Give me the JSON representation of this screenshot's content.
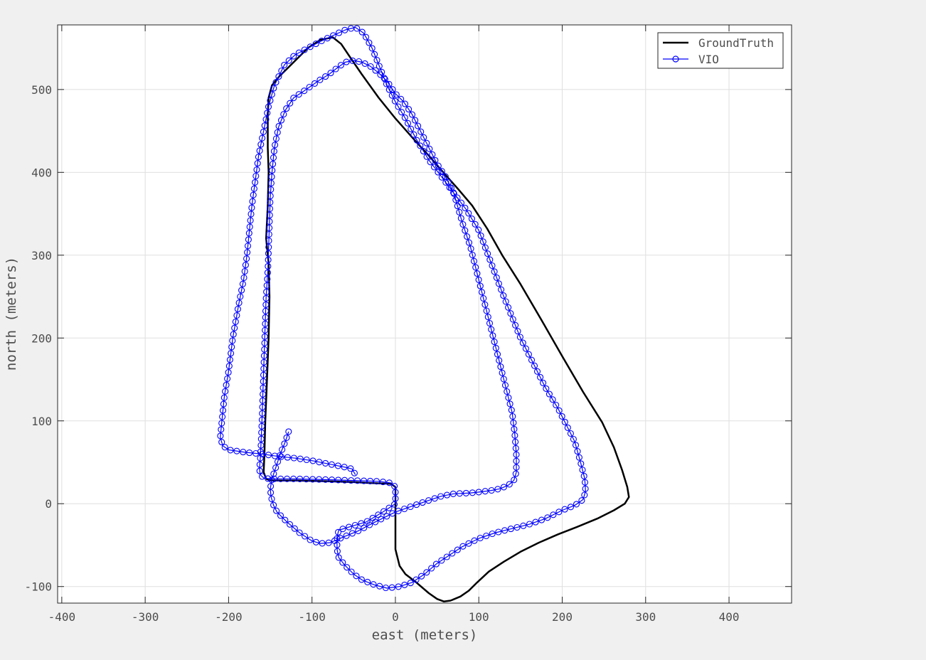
{
  "chart_data": {
    "type": "line",
    "title": "",
    "xlabel": "east (meters)",
    "ylabel": "north (meters)",
    "xlim": [
      -405,
      475
    ],
    "ylim": [
      -120,
      578
    ],
    "xticks": [
      -400,
      -300,
      -200,
      -100,
      0,
      100,
      200,
      300,
      400
    ],
    "yticks": [
      -100,
      0,
      100,
      200,
      300,
      400,
      500
    ],
    "grid": true,
    "legend_position": "top-right",
    "series": [
      {
        "name": "GroundTruth",
        "color": "#000000",
        "marker": "none",
        "points": [
          [
            -155,
            30
          ],
          [
            -150,
            28
          ],
          [
            -120,
            28
          ],
          [
            -80,
            27
          ],
          [
            -50,
            26
          ],
          [
            -30,
            25
          ],
          [
            -5,
            24
          ],
          [
            0,
            20
          ],
          [
            0,
            10
          ],
          [
            0,
            -30
          ],
          [
            0,
            -55
          ],
          [
            5,
            -75
          ],
          [
            12,
            -85
          ],
          [
            25,
            -95
          ],
          [
            40,
            -108
          ],
          [
            50,
            -115
          ],
          [
            58,
            -118
          ],
          [
            66,
            -117
          ],
          [
            78,
            -112
          ],
          [
            88,
            -105
          ],
          [
            98,
            -95
          ],
          [
            112,
            -82
          ],
          [
            130,
            -70
          ],
          [
            150,
            -58
          ],
          [
            172,
            -47
          ],
          [
            195,
            -37
          ],
          [
            218,
            -28
          ],
          [
            242,
            -18
          ],
          [
            262,
            -8
          ],
          [
            275,
            0
          ],
          [
            280,
            8
          ],
          [
            278,
            20
          ],
          [
            272,
            40
          ],
          [
            262,
            68
          ],
          [
            248,
            98
          ],
          [
            225,
            135
          ],
          [
            200,
            178
          ],
          [
            175,
            222
          ],
          [
            150,
            265
          ],
          [
            128,
            300
          ],
          [
            110,
            332
          ],
          [
            92,
            360
          ],
          [
            75,
            380
          ],
          [
            60,
            397
          ],
          [
            42,
            418
          ],
          [
            22,
            440
          ],
          [
            0,
            465
          ],
          [
            -20,
            490
          ],
          [
            -40,
            518
          ],
          [
            -55,
            540
          ],
          [
            -65,
            555
          ],
          [
            -75,
            563
          ],
          [
            -90,
            560
          ],
          [
            -105,
            550
          ],
          [
            -125,
            530
          ],
          [
            -140,
            515
          ],
          [
            -148,
            505
          ],
          [
            -152,
            490
          ],
          [
            -153,
            470
          ],
          [
            -153,
            430
          ],
          [
            -152,
            400
          ],
          [
            -153,
            360
          ],
          [
            -155,
            320
          ],
          [
            -152,
            290
          ],
          [
            -151,
            250
          ],
          [
            -152,
            200
          ],
          [
            -154,
            150
          ],
          [
            -156,
            100
          ],
          [
            -157,
            60
          ],
          [
            -158,
            38
          ],
          [
            -155,
            30
          ]
        ]
      },
      {
        "name": "VIO",
        "color": "#0000ff",
        "marker": "circle",
        "points": [
          [
            -128,
            87
          ],
          [
            -132,
            75
          ],
          [
            -138,
            60
          ],
          [
            -143,
            45
          ],
          [
            -148,
            30
          ],
          [
            -150,
            18
          ],
          [
            -149,
            8
          ],
          [
            -146,
            -2
          ],
          [
            -142,
            -10
          ],
          [
            -130,
            -22
          ],
          [
            -115,
            -35
          ],
          [
            -100,
            -45
          ],
          [
            -90,
            -48
          ],
          [
            -78,
            -47
          ],
          [
            -62,
            -40
          ],
          [
            -45,
            -33
          ],
          [
            -30,
            -25
          ],
          [
            -10,
            -15
          ],
          [
            0,
            -10
          ],
          [
            20,
            -3
          ],
          [
            40,
            4
          ],
          [
            55,
            9
          ],
          [
            70,
            12
          ],
          [
            90,
            13
          ],
          [
            100,
            14
          ],
          [
            115,
            16
          ],
          [
            125,
            18
          ],
          [
            135,
            22
          ],
          [
            142,
            28
          ],
          [
            145,
            38
          ],
          [
            145,
            60
          ],
          [
            143,
            85
          ],
          [
            140,
            110
          ],
          [
            130,
            150
          ],
          [
            120,
            190
          ],
          [
            110,
            230
          ],
          [
            100,
            270
          ],
          [
            90,
            310
          ],
          [
            80,
            340
          ],
          [
            70,
            375
          ],
          [
            60,
            395
          ],
          [
            50,
            410
          ],
          [
            40,
            430
          ],
          [
            30,
            450
          ],
          [
            20,
            470
          ],
          [
            10,
            485
          ],
          [
            0,
            495
          ],
          [
            -10,
            510
          ],
          [
            -20,
            520
          ],
          [
            -30,
            528
          ],
          [
            -40,
            533
          ],
          [
            -50,
            535
          ],
          [
            -60,
            533
          ],
          [
            -70,
            526
          ],
          [
            -80,
            518
          ],
          [
            -90,
            512
          ],
          [
            -100,
            505
          ],
          [
            -110,
            498
          ],
          [
            -122,
            490
          ],
          [
            -132,
            475
          ],
          [
            -140,
            455
          ],
          [
            -145,
            430
          ],
          [
            -148,
            400
          ],
          [
            -150,
            370
          ],
          [
            -151,
            340
          ],
          [
            -152,
            310
          ],
          [
            -153,
            280
          ],
          [
            -155,
            250
          ],
          [
            -156,
            220
          ],
          [
            -157,
            190
          ],
          [
            -158,
            160
          ],
          [
            -159,
            130
          ],
          [
            -160,
            100
          ],
          [
            -161,
            75
          ],
          [
            -162,
            55
          ],
          [
            -163,
            42
          ],
          [
            -162,
            35
          ],
          [
            -158,
            31
          ],
          [
            -150,
            30
          ],
          [
            -120,
            30
          ],
          [
            -80,
            29
          ],
          [
            -50,
            28
          ],
          [
            -20,
            27
          ],
          [
            -5,
            25
          ],
          [
            0,
            20
          ],
          [
            0,
            10
          ],
          [
            0,
            0
          ],
          [
            -15,
            -10
          ],
          [
            -35,
            -22
          ],
          [
            -55,
            -28
          ],
          [
            -68,
            -32
          ],
          [
            -70,
            -40
          ],
          [
            -70,
            -55
          ],
          [
            -68,
            -65
          ],
          [
            -60,
            -75
          ],
          [
            -50,
            -85
          ],
          [
            -40,
            -92
          ],
          [
            -25,
            -98
          ],
          [
            -10,
            -102
          ],
          [
            5,
            -100
          ],
          [
            20,
            -95
          ],
          [
            35,
            -85
          ],
          [
            50,
            -72
          ],
          [
            65,
            -62
          ],
          [
            80,
            -52
          ],
          [
            100,
            -42
          ],
          [
            120,
            -35
          ],
          [
            140,
            -30
          ],
          [
            160,
            -25
          ],
          [
            180,
            -18
          ],
          [
            200,
            -8
          ],
          [
            215,
            -2
          ],
          [
            225,
            5
          ],
          [
            228,
            15
          ],
          [
            227,
            30
          ],
          [
            222,
            50
          ],
          [
            215,
            75
          ],
          [
            205,
            95
          ],
          [
            195,
            115
          ],
          [
            180,
            140
          ],
          [
            165,
            170
          ],
          [
            150,
            200
          ],
          [
            140,
            225
          ],
          [
            128,
            255
          ],
          [
            115,
            290
          ],
          [
            100,
            330
          ],
          [
            85,
            355
          ],
          [
            70,
            375
          ],
          [
            55,
            395
          ],
          [
            40,
            415
          ],
          [
            25,
            440
          ],
          [
            12,
            465
          ],
          [
            0,
            485
          ],
          [
            -10,
            505
          ],
          [
            -20,
            530
          ],
          [
            -28,
            550
          ],
          [
            -38,
            568
          ],
          [
            -48,
            575
          ],
          [
            -60,
            572
          ],
          [
            -75,
            565
          ],
          [
            -90,
            558
          ],
          [
            -105,
            550
          ],
          [
            -120,
            542
          ],
          [
            -133,
            530
          ],
          [
            -145,
            505
          ],
          [
            -152,
            480
          ],
          [
            -158,
            450
          ],
          [
            -164,
            420
          ],
          [
            -168,
            390
          ],
          [
            -172,
            360
          ],
          [
            -175,
            330
          ],
          [
            -178,
            300
          ],
          [
            -182,
            270
          ],
          [
            -188,
            240
          ],
          [
            -195,
            200
          ],
          [
            -200,
            160
          ],
          [
            -205,
            130
          ],
          [
            -208,
            100
          ],
          [
            -210,
            80
          ],
          [
            -207,
            70
          ],
          [
            -200,
            65
          ],
          [
            -180,
            62
          ],
          [
            -160,
            60
          ],
          [
            -140,
            57
          ],
          [
            -120,
            55
          ],
          [
            -100,
            52
          ],
          [
            -80,
            48
          ],
          [
            -70,
            46
          ],
          [
            -60,
            44
          ],
          [
            -52,
            42
          ],
          [
            -48,
            35
          ]
        ]
      }
    ]
  }
}
